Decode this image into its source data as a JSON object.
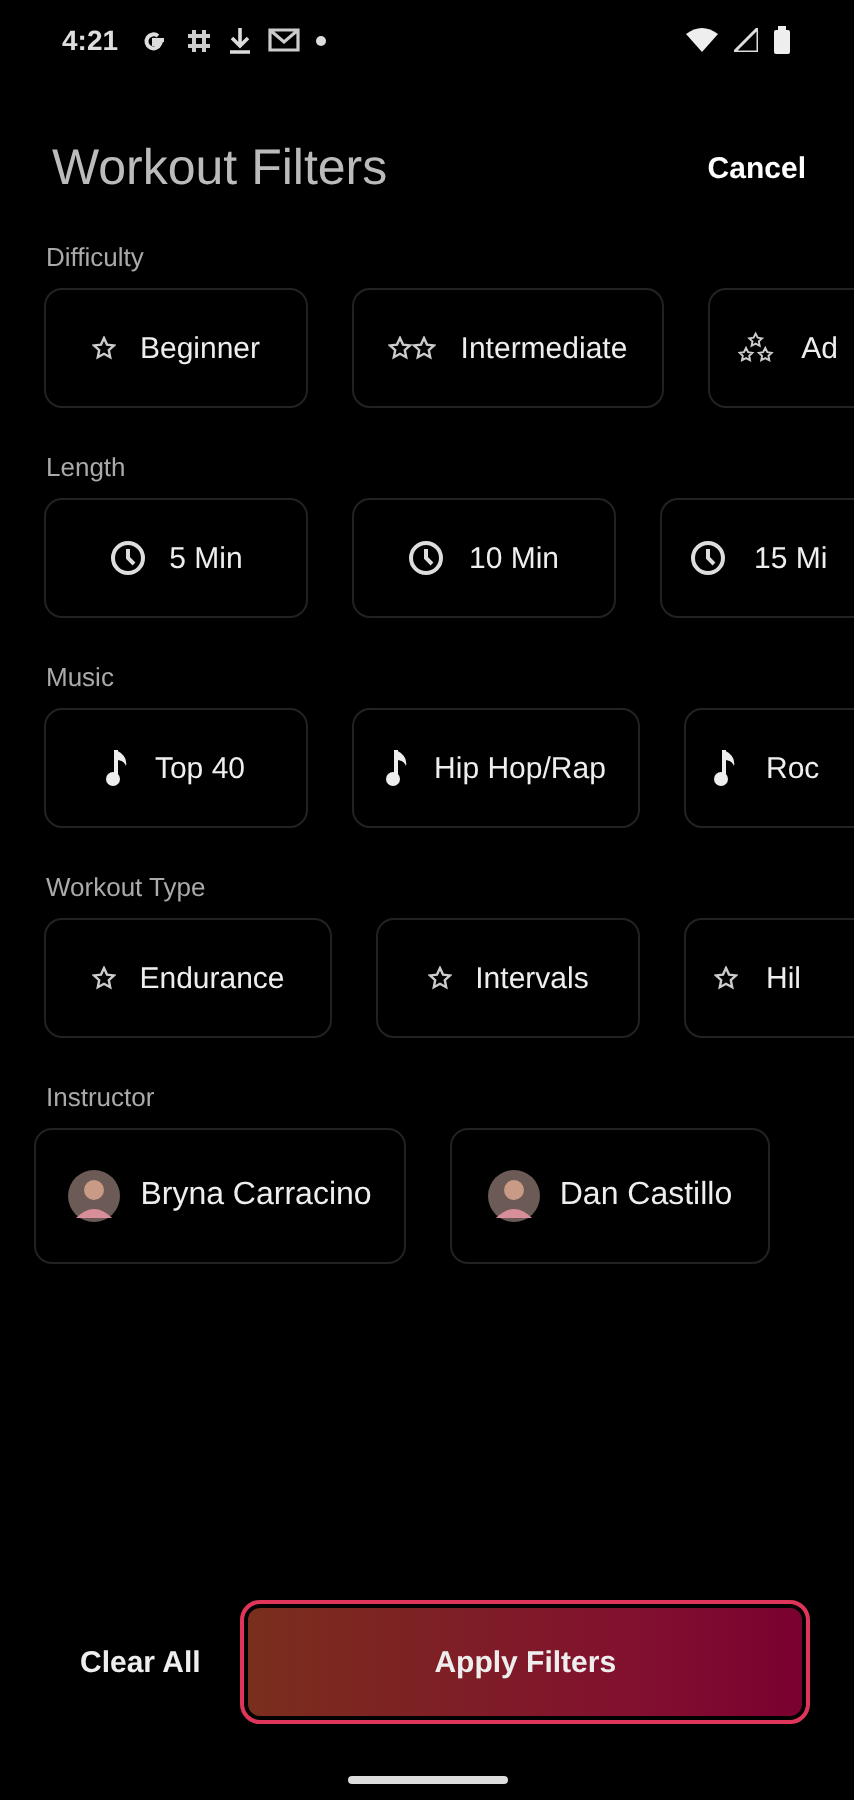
{
  "status_bar": {
    "time": "4:21"
  },
  "header": {
    "title": "Workout Filters",
    "cancel": "Cancel"
  },
  "sections": [
    {
      "label": "Difficulty",
      "options": [
        {
          "label": "Beginner",
          "kind": "star"
        },
        {
          "label": "Intermediate",
          "kind": "twostar"
        },
        {
          "label": "Ad",
          "kind": "threestar"
        }
      ]
    },
    {
      "label": "Length",
      "options": [
        {
          "label": "5 Min",
          "kind": "clock"
        },
        {
          "label": "10 Min",
          "kind": "clock"
        },
        {
          "label": "15 Mi",
          "kind": "clock"
        }
      ]
    },
    {
      "label": "Music",
      "options": [
        {
          "label": "Top 40",
          "kind": "note"
        },
        {
          "label": "Hip Hop/Rap",
          "kind": "note"
        },
        {
          "label": "Roc",
          "kind": "note"
        }
      ]
    },
    {
      "label": "Workout Type",
      "options": [
        {
          "label": "Endurance",
          "kind": "star"
        },
        {
          "label": "Intervals",
          "kind": "star"
        },
        {
          "label": "Hil",
          "kind": "star"
        }
      ]
    },
    {
      "label": "Instructor",
      "options": [
        {
          "label": "Bryna Carracino",
          "kind": "person"
        },
        {
          "label": "Dan Castillo",
          "kind": "person"
        }
      ]
    }
  ],
  "footer": {
    "clear": "Clear All",
    "apply": "Apply Filters"
  }
}
